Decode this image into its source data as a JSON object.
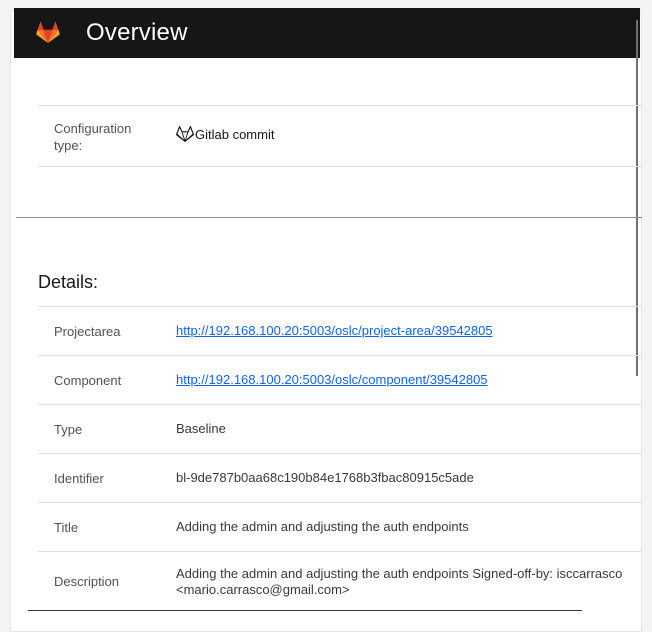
{
  "header": {
    "title": "Overview",
    "logo_icon": "gitlab-logo-icon"
  },
  "configuration": {
    "label": "Configuration type:",
    "value": "Gitlab commit",
    "icon": "gitlab-outline-icon"
  },
  "details": {
    "heading": "Details:",
    "rows": [
      {
        "label": "Projectarea",
        "value": "http://192.168.100.20:5003/oslc/project-area/39542805",
        "is_link": true
      },
      {
        "label": "Component",
        "value": "http://192.168.100.20:5003/oslc/component/39542805",
        "is_link": true
      },
      {
        "label": "Type",
        "value": "Baseline",
        "is_link": false
      },
      {
        "label": "Identifier",
        "value": "bl-9de787b0aa68c190b84e1768b3fbac80915c5ade",
        "is_link": false
      },
      {
        "label": "Title",
        "value": "Adding the admin and adjusting the auth endpoints",
        "is_link": false
      },
      {
        "label": "Description",
        "value": "Adding the admin and adjusting the auth endpoints Signed-off-by: isccarrasco <mario.carrasco@gmail.com>",
        "is_link": false
      }
    ]
  },
  "colors": {
    "header_bg": "#161616",
    "link": "#0f62fe",
    "gitlab_orange": "#fc6d26"
  }
}
